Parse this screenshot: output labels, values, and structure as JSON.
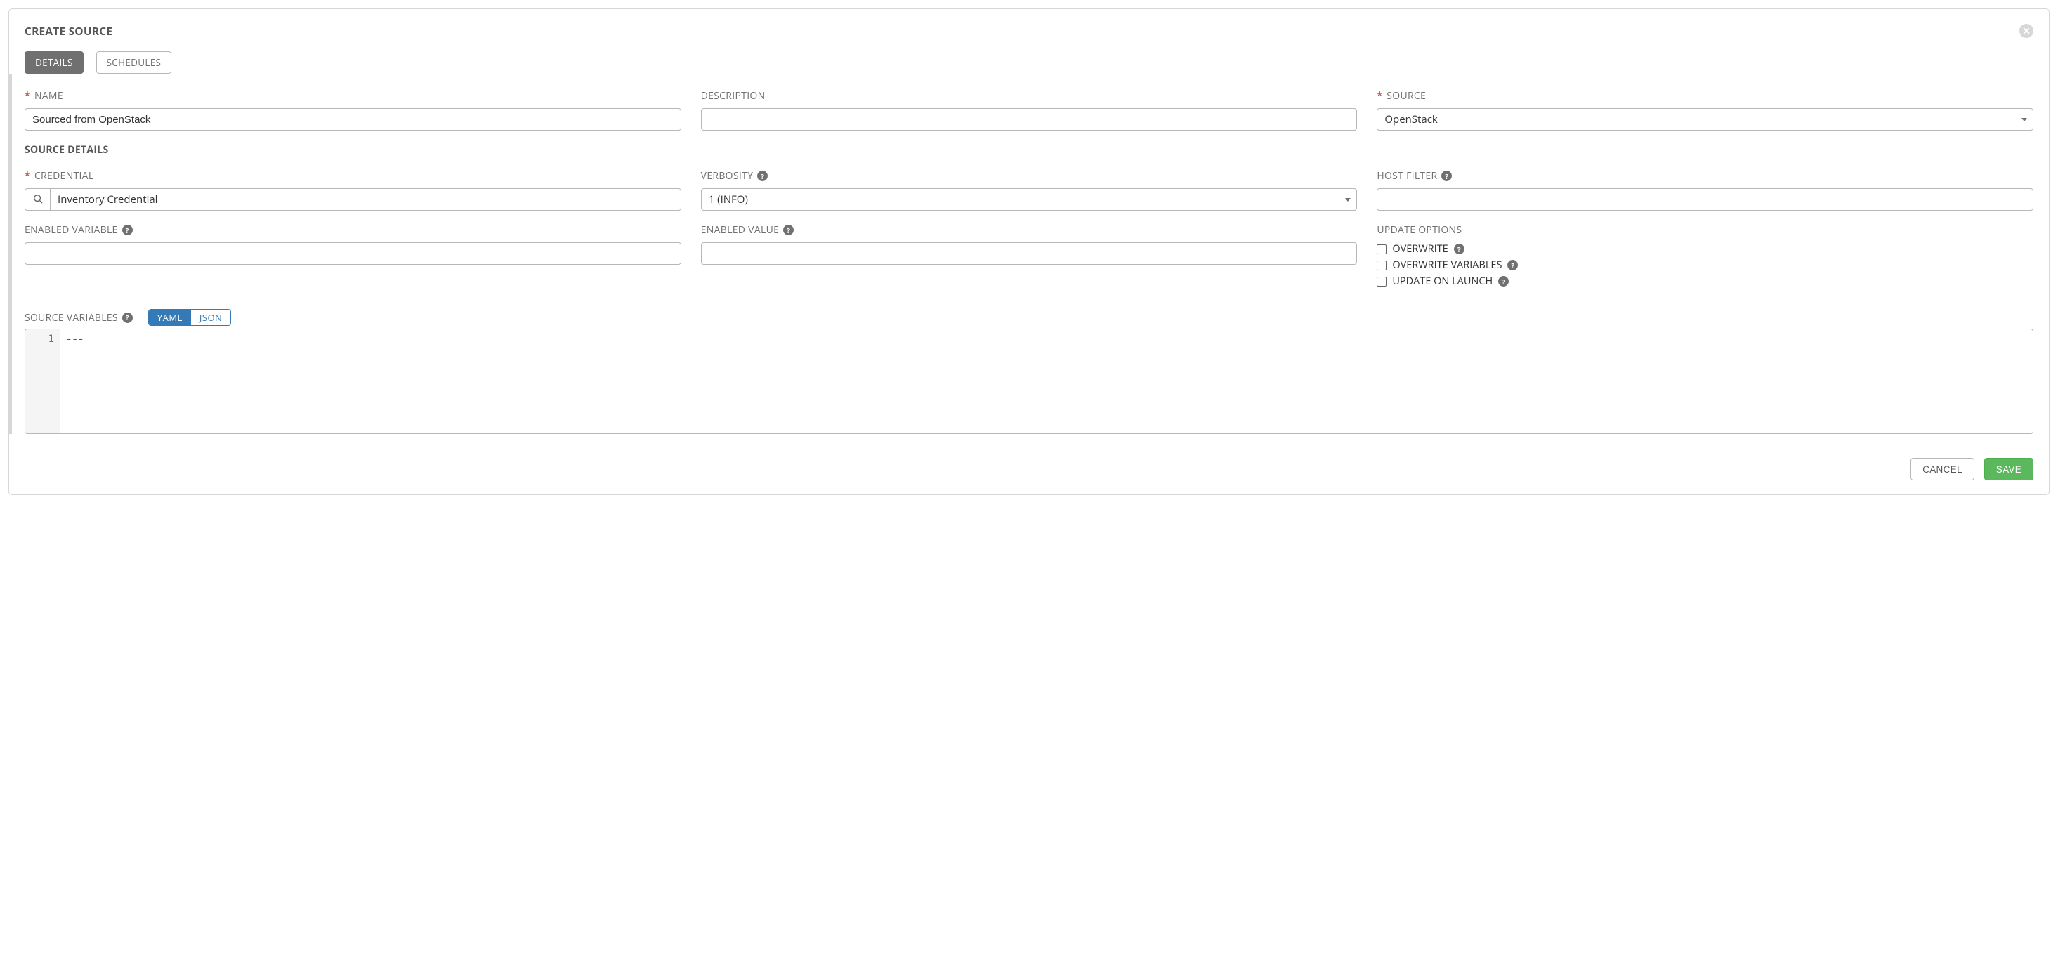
{
  "header": {
    "title": "CREATE SOURCE"
  },
  "tabs": {
    "details": "DETAILS",
    "schedules": "SCHEDULES"
  },
  "fields": {
    "name": {
      "label": "NAME",
      "value": "Sourced from OpenStack"
    },
    "description": {
      "label": "DESCRIPTION",
      "value": ""
    },
    "source": {
      "label": "SOURCE",
      "value": "OpenStack"
    }
  },
  "source_details": {
    "heading": "SOURCE DETAILS",
    "credential": {
      "label": "CREDENTIAL",
      "value": "Inventory Credential"
    },
    "verbosity": {
      "label": "VERBOSITY",
      "value": "1 (INFO)"
    },
    "host_filter": {
      "label": "HOST FILTER",
      "value": ""
    },
    "enabled_variable": {
      "label": "ENABLED VARIABLE",
      "value": ""
    },
    "enabled_value": {
      "label": "ENABLED VALUE",
      "value": ""
    },
    "update_options": {
      "label": "UPDATE OPTIONS",
      "overwrite": "OVERWRITE",
      "overwrite_vars": "OVERWRITE VARIABLES",
      "update_on_launch": "UPDATE ON LAUNCH"
    }
  },
  "source_variables": {
    "label": "SOURCE VARIABLES",
    "format_yaml": "YAML",
    "format_json": "JSON",
    "line_number": "1",
    "content": "---"
  },
  "footer": {
    "cancel": "CANCEL",
    "save": "SAVE"
  }
}
